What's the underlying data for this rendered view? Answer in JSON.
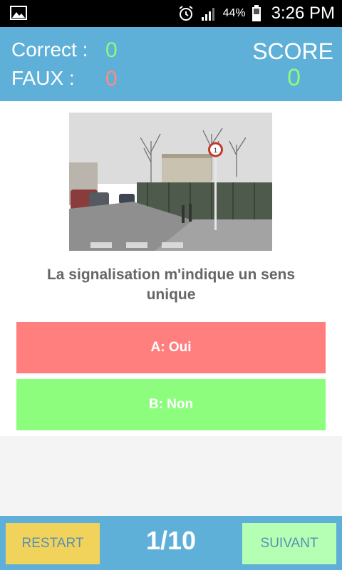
{
  "status_bar": {
    "battery_percent": "44%",
    "time": "3:26 PM",
    "icons": [
      "gallery-icon",
      "alarm-icon",
      "signal-icon",
      "battery-icon"
    ]
  },
  "score_panel": {
    "correct_label": "Correct :",
    "correct_value": "0",
    "faux_label": "FAUX :",
    "faux_value": "0",
    "score_label": "SCORE",
    "score_value": "0"
  },
  "question": {
    "text": "La signalisation m'indique un sens unique"
  },
  "answers": [
    {
      "label": "A: Oui",
      "color": "#ff7f7f"
    },
    {
      "label": "B: Non",
      "color": "#8cfd7d"
    }
  ],
  "footer": {
    "restart_label": "RESTART",
    "progress": "1/10",
    "next_label": "SUIVANT"
  },
  "colors": {
    "header": "#5fb0d8",
    "correct": "#8dfa7d",
    "faux": "#ff8a84",
    "restart_button": "#f1d35b",
    "next_button": "#b4ffb4"
  }
}
